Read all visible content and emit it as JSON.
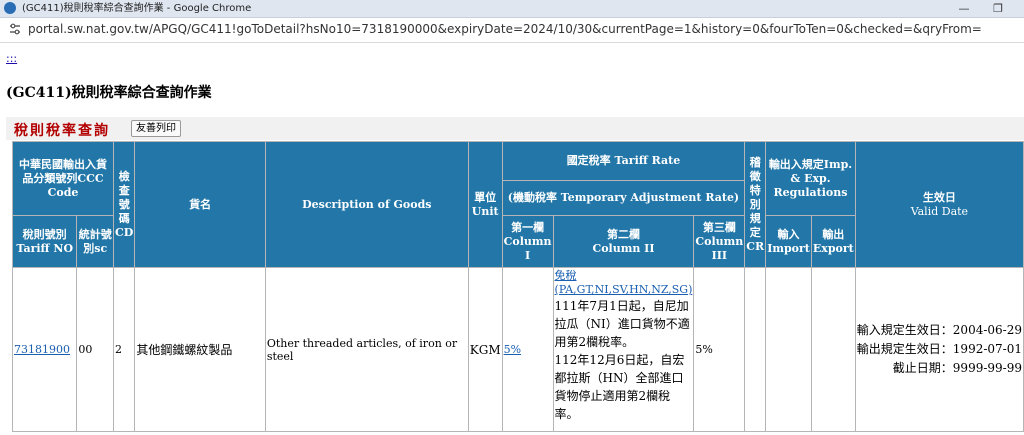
{
  "browser": {
    "window_title": "(GC411)稅則稅率綜合查詢作業 - Google Chrome",
    "url": "portal.sw.nat.gov.tw/APGQ/GC411!goToDetail?hsNo10=7318190000&expiryDate=2024/10/30&currentPage=1&history=0&fourToTen=0&checked=&qryFrom=",
    "minimize": "—",
    "restore": "❐"
  },
  "page": {
    "skip_link": ":::",
    "title": "(GC411)稅則稅率綜合查詢作業",
    "section_title": "稅則稅率查詢",
    "print_button": "友善列印"
  },
  "header": {
    "ccc_code": "中華民國輸出入貨品分類號列CCC Code",
    "cd": "檢查號碼CD",
    "goods_zh": "貨名",
    "goods_en": "Description of Goods",
    "unit": "單位Unit",
    "tariff_rate": "國定稅率 Tariff Rate",
    "temp_rate": "(機動稅率 Temporary Adjustment Rate)",
    "cr": "稽徵特別規定CR",
    "regulation": "輸出入規定Imp. & Exp. Regulations",
    "valid_date_zh": "生效日",
    "valid_date_en": "Valid Date",
    "tariff_no": "稅則號別Tariff NO",
    "sc": "統計號別sc",
    "col1": "第一欄Column I",
    "col2_zh": "第二欄",
    "col2_en": "Column II",
    "col3": "第三欄Column III",
    "import": "輸入Import",
    "export": "輸出Export"
  },
  "row": {
    "tariff_no": "73181900",
    "sc": "00",
    "cd": "2",
    "goods_zh": "其他鋼鐵螺紋製品",
    "goods_en": "Other threaded articles, of iron or steel",
    "unit": "KGM",
    "col1": "5%",
    "col2_link": "免稅(PA,GT,NI,SV,HN,NZ,SG)",
    "col2_note1": "111年7月1日起，自尼加拉瓜（NI）進口貨物不適用第2欄稅率。",
    "col2_note2": "112年12月6日起，自宏都拉斯（HN）全部進口貨物停止適用第2欄稅率。",
    "col3": "5%",
    "cr": "",
    "import": "",
    "export": "",
    "import_date": "輸入規定生效日：2004-06-29",
    "export_date": "輸出規定生效日：1992-07-01",
    "expiry_date": "截止日期：9999-99-99"
  }
}
